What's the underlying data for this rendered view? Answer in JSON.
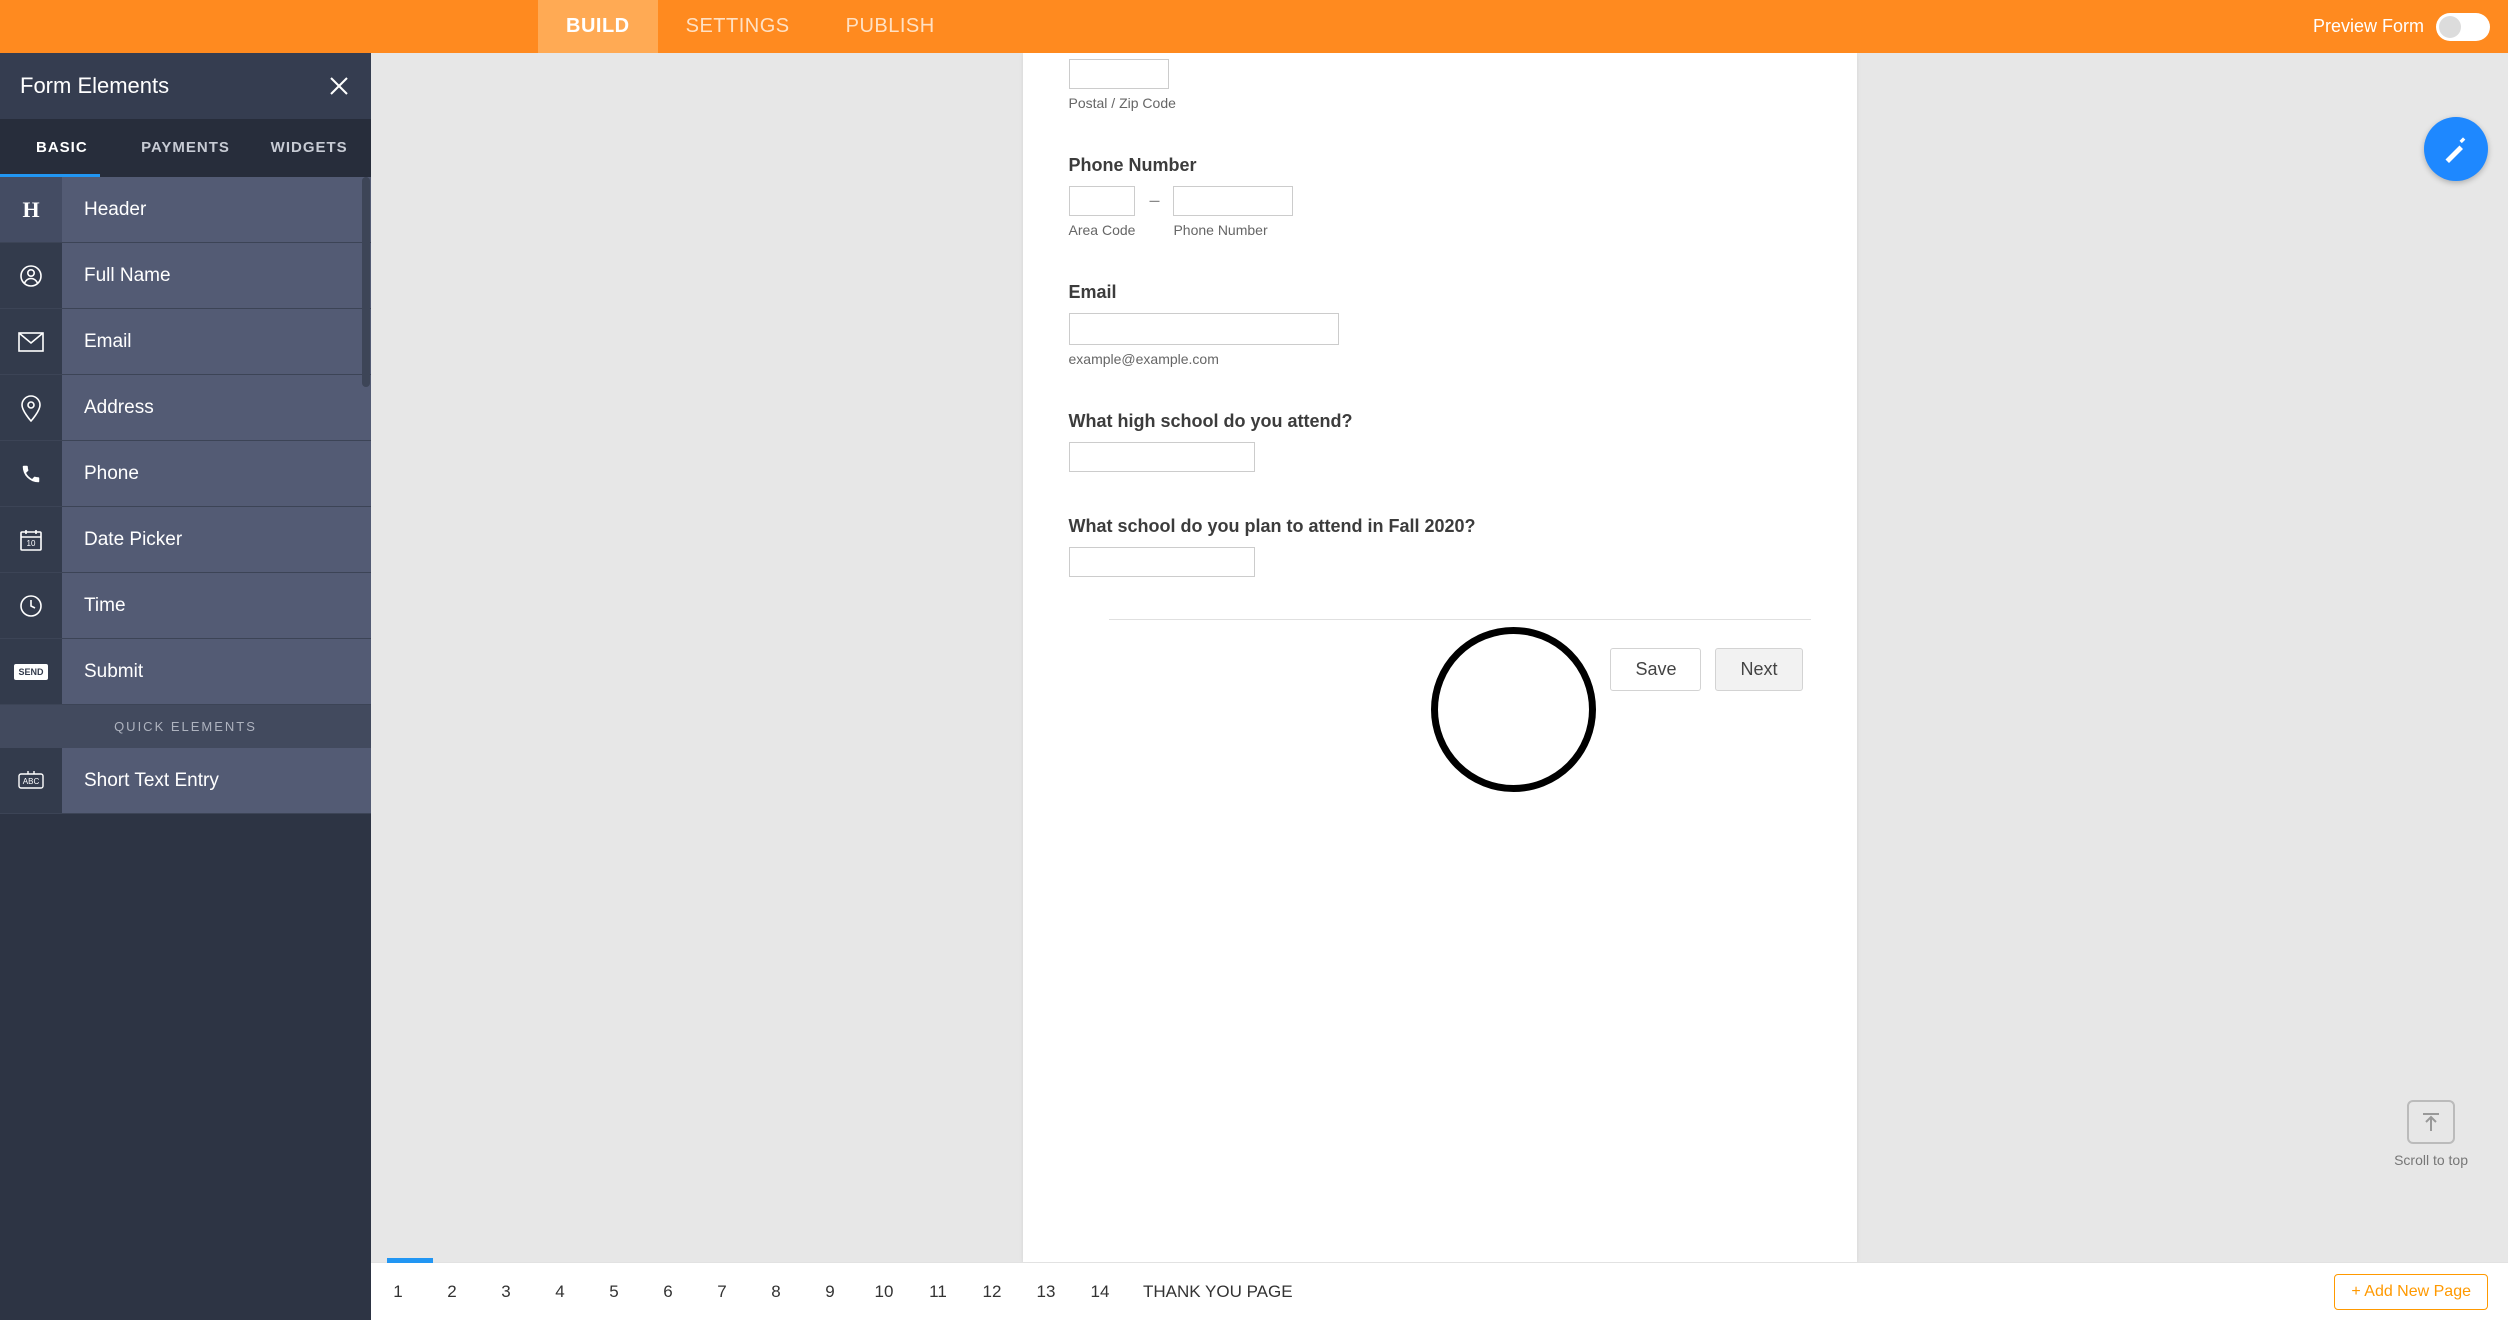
{
  "topbar": {
    "tabs": [
      "BUILD",
      "SETTINGS",
      "PUBLISH"
    ],
    "preview_label": "Preview Form"
  },
  "sidebar": {
    "title": "Form Elements",
    "subtabs": [
      "BASIC",
      "PAYMENTS",
      "WIDGETS"
    ],
    "items": [
      {
        "label": "Header",
        "icon": "H"
      },
      {
        "label": "Full Name",
        "icon": "person"
      },
      {
        "label": "Email",
        "icon": "mail"
      },
      {
        "label": "Address",
        "icon": "pin"
      },
      {
        "label": "Phone",
        "icon": "phone"
      },
      {
        "label": "Date Picker",
        "icon": "calendar"
      },
      {
        "label": "Time",
        "icon": "clock"
      },
      {
        "label": "Submit",
        "icon": "send"
      }
    ],
    "quick_header": "QUICK ELEMENTS",
    "quick_items": [
      {
        "label": "Short Text Entry",
        "icon": "abc"
      }
    ]
  },
  "form": {
    "postal_sublabel": "Postal / Zip Code",
    "phone_label": "Phone Number",
    "area_code_sublabel": "Area Code",
    "phone_number_sublabel": "Phone Number",
    "email_label": "Email",
    "email_placeholder": "example@example.com",
    "hs_label": "What high school do you attend?",
    "plan_label": "What school do you plan to attend in Fall 2020?",
    "save_label": "Save",
    "next_label": "Next"
  },
  "scroll_top": "Scroll to top",
  "pager": {
    "pages": [
      "1",
      "2",
      "3",
      "4",
      "5",
      "6",
      "7",
      "8",
      "9",
      "10",
      "11",
      "12",
      "13",
      "14"
    ],
    "thank_you": "THANK YOU PAGE",
    "add": "+ Add New Page"
  }
}
